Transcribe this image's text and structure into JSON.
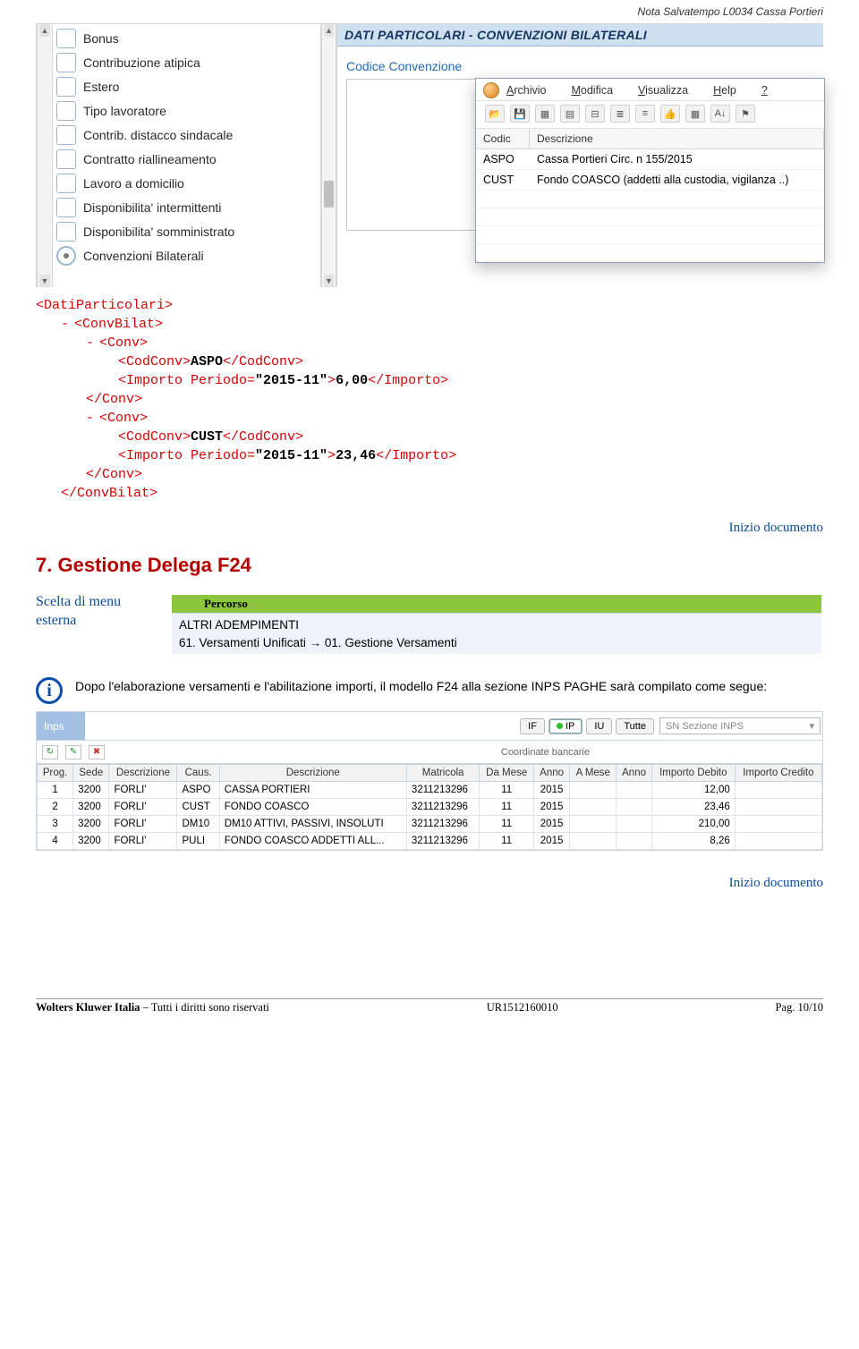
{
  "page_header": "Nota Salvatempo  L0034 Cassa Portieri",
  "options": [
    "Bonus",
    "Contribuzione atipica",
    "Estero",
    "Tipo lavoratore",
    "Contrib. distacco sindacale",
    "Contratto riallineamento",
    "Lavoro a domicilio",
    "Disponibilita' intermittenti",
    "Disponibilita' somministrato",
    "Convenzioni Bilaterali"
  ],
  "pane": {
    "title": "DATI PARTICOLARI - CONVENZIONI BILATERALI",
    "subtitle": "Codice Convenzione"
  },
  "popup": {
    "menu": [
      "Archivio",
      "Modifica",
      "Visualizza",
      "Help",
      "?"
    ],
    "cols": [
      "Codic",
      "Descrizione"
    ],
    "rows": [
      {
        "c": "ASPO",
        "d": "Cassa Portieri Circ. n 155/2015"
      },
      {
        "c": "CUST",
        "d": "Fondo COASCO (addetti alla custodia, vigilanza ..)"
      }
    ]
  },
  "xml": {
    "root_open": "<DatiParticolari>",
    "cb_open": "<ConvBilat>",
    "conv_open": "<Conv>",
    "cod_open": "<CodConv>",
    "cod_close": "</CodConv>",
    "imp_open": "<Importo Periodo=",
    "imp_attr": "\"2015-11\"",
    "imp_gt": ">",
    "imp_close": "</Importo>",
    "conv_close": "</Conv>",
    "cb_close": "</ConvBilat>",
    "v_aspo": "ASPO",
    "v_cust": "CUST",
    "v_6": "6,00",
    "v_23": "23,46"
  },
  "link": "Inizio documento",
  "section7": {
    "num": "7.",
    "title": "Gestione  Delega F24",
    "menu_lbl": "Scelta di menu esterna",
    "path_head": "Percorso",
    "path1": "ALTRI ADEMPIMENTI",
    "path2": "61. Versamenti Unificati → 01. Gestione Versamenti"
  },
  "info_text": "Dopo l'elaborazione versamenti e l'abilitazione importi, il modello F24 alla sezione INPS PAGHE sarà compilato come segue:",
  "inps": {
    "tab": "Inps",
    "btns": [
      "IF",
      "IP",
      "IU",
      "Tutte"
    ],
    "dd": "SN Sezione INPS",
    "coord": "Coordinate bancarie",
    "headers": [
      "Prog.",
      "Sede",
      "Descrizione",
      "Caus.",
      "Descrizione",
      "Matricola",
      "Da Mese",
      "Anno",
      "A Mese",
      "Anno",
      "Importo Debito",
      "Importo Credito"
    ],
    "rows": [
      {
        "p": "1",
        "s": "3200",
        "ds": "FORLI'",
        "c": "ASPO",
        "d2": "CASSA PORTIERI",
        "m": "3211213296",
        "dm": "11",
        "an": "2015",
        "am": "",
        "an2": "",
        "deb": "12,00",
        "cr": ""
      },
      {
        "p": "2",
        "s": "3200",
        "ds": "FORLI'",
        "c": "CUST",
        "d2": "FONDO COASCO",
        "m": "3211213296",
        "dm": "11",
        "an": "2015",
        "am": "",
        "an2": "",
        "deb": "23,46",
        "cr": ""
      },
      {
        "p": "3",
        "s": "3200",
        "ds": "FORLI'",
        "c": "DM10",
        "d2": "DM10 ATTIVI, PASSIVI, INSOLUTI",
        "m": "3211213296",
        "dm": "11",
        "an": "2015",
        "am": "",
        "an2": "",
        "deb": "210,00",
        "cr": ""
      },
      {
        "p": "4",
        "s": "3200",
        "ds": "FORLI'",
        "c": "PULI",
        "d2": "FONDO COASCO ADDETTI ALL...",
        "m": "3211213296",
        "dm": "11",
        "an": "2015",
        "am": "",
        "an2": "",
        "deb": "8,26",
        "cr": ""
      }
    ]
  },
  "footer": {
    "brand": "Wolters Kluwer Italia",
    "rights": " – Tutti i diritti sono riservati",
    "code": "UR1512160010",
    "page": "Pag. 10/10"
  }
}
